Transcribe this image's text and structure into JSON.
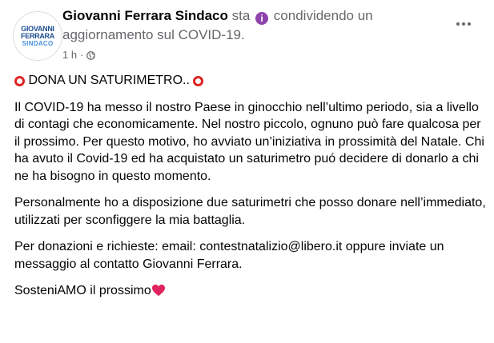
{
  "header": {
    "avatar_line1": "GIOVANNI",
    "avatar_line2": "FERRARA",
    "avatar_line3": "SINDACO",
    "author": "Giovanni Ferrara Sindaco",
    "status_pre": "sta",
    "status_post": "condividendo un aggiornamento sul COVID-19.",
    "time": "1 h",
    "separator": "·",
    "info_icon": "i"
  },
  "post": {
    "title": "DONA UN SATURIMETRO..",
    "p1": "Il COVID-19 ha messo il nostro Paese in ginocchio  nell’ultimo periodo, sia a livello di contagi che economicamente. Nel nostro piccolo, ognuno può fare qualcosa per il prossimo. Per questo motivo, ho avviato un’iniziativa in prossimità del Natale. Chi ha avuto il Covid-19 ed ha acquistato un saturimetro puó decidere di donarlo a chi ne ha bisogno in questo momento.",
    "p2": "Personalmente ho a disposizione due saturimetri che posso donare nell’immediato, utilizzati per sconfiggere la mia battaglia.",
    "p3": "Per donazioni e richieste: email: contestnatalizio@libero.it oppure inviate un messaggio al contatto Giovanni Ferrara.",
    "p4": "SosteniAMO il prossimo"
  },
  "icons": {
    "title_marker": "red-circle-icon",
    "closing": "heart-icon",
    "privacy": "globe-icon",
    "menu": "more-options-icon"
  },
  "colors": {
    "author": "#050505",
    "secondary": "#65676b",
    "info_badge": "#8e44ad",
    "red_marker": "#e02424",
    "heart": "#e0245e"
  }
}
